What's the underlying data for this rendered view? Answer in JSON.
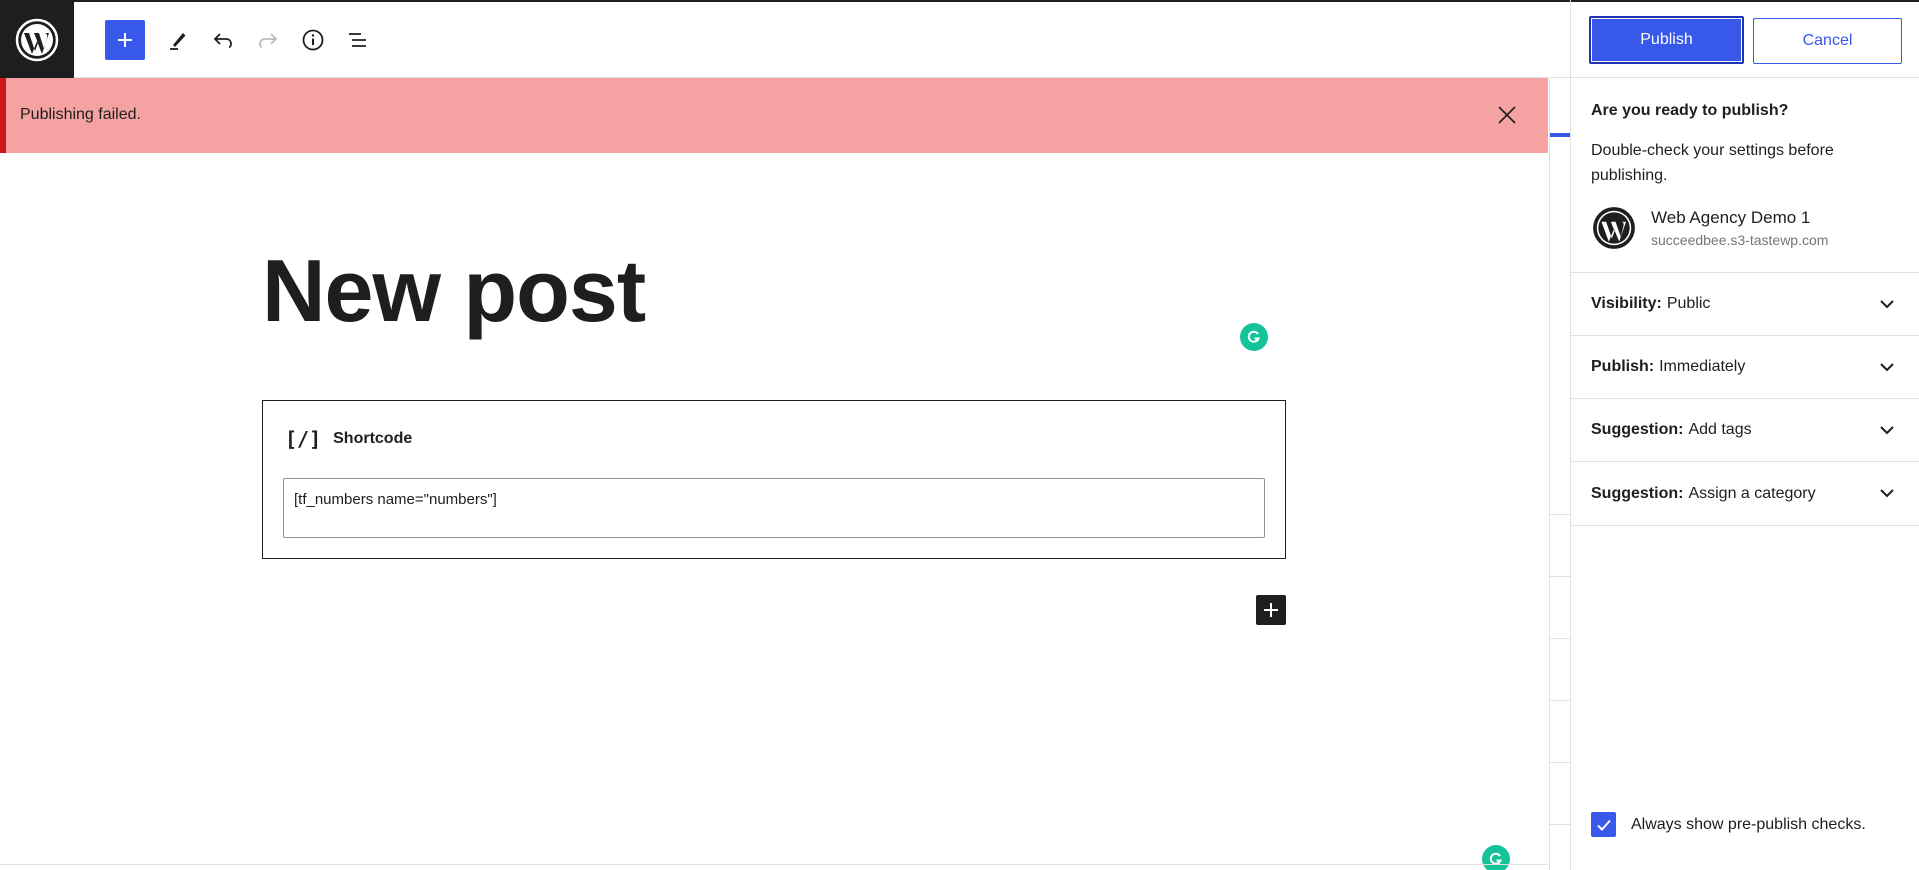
{
  "toolbar": {
    "logo_icon": "wordpress-logo-icon",
    "add_block_icon": "plus-icon",
    "tools_icon": "pencil-icon",
    "undo_icon": "undo-icon",
    "redo_icon": "redo-icon",
    "details_icon": "info-icon",
    "list_view_icon": "list-view-icon"
  },
  "notice": {
    "text": "Publishing failed.",
    "close_icon": "close-icon",
    "background": "#f4a2a2",
    "border_color": "#cc1818"
  },
  "post": {
    "title": "New post"
  },
  "shortcode_block": {
    "icon_text": "[/]",
    "label": "Shortcode",
    "value": "[tf_numbers name=\"numbers\"]"
  },
  "sidebar": {
    "publish_label": "Publish",
    "cancel_label": "Cancel",
    "prepublish": {
      "title": "Are you ready to publish?",
      "description": "Double-check your settings before publishing.",
      "site_name": "Web Agency Demo 1",
      "site_url": "succeedbee.s3-tastewp.com"
    },
    "panels": [
      {
        "key": "Visibility:",
        "value": "Public"
      },
      {
        "key": "Publish:",
        "value": "Immediately"
      },
      {
        "key": "Suggestion:",
        "value": "Add tags"
      },
      {
        "key": "Suggestion:",
        "value": "Assign a category"
      }
    ],
    "always_show_label": "Always show pre-publish checks.",
    "always_show_checked": true
  },
  "colors": {
    "accent": "#3858e9",
    "dark": "#1e1e1e",
    "grammarly": "#15c39a"
  }
}
